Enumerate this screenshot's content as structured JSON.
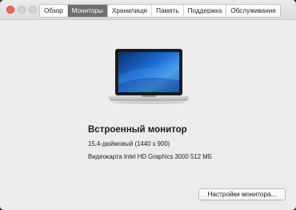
{
  "tabs": [
    {
      "label": "Обзор",
      "active": false
    },
    {
      "label": "Мониторы",
      "active": true
    },
    {
      "label": "Хранилище",
      "active": false
    },
    {
      "label": "Память",
      "active": false
    },
    {
      "label": "Поддержка",
      "active": false
    },
    {
      "label": "Обслуживание",
      "active": false
    }
  ],
  "display": {
    "name": "Встроенный монитор",
    "size": "15,4-дюймовый (1440 x 900)",
    "gpu": "Видеокарта Intel HD Graphics 3000 512 МБ"
  },
  "buttons": {
    "settings": "Настройки монитора..."
  },
  "colors": {
    "close": "#fc5f57",
    "active_tab": "#6e6e6e",
    "window_bg": "#ececec"
  },
  "icons": {
    "display_image": "macbook-pro-icon"
  }
}
